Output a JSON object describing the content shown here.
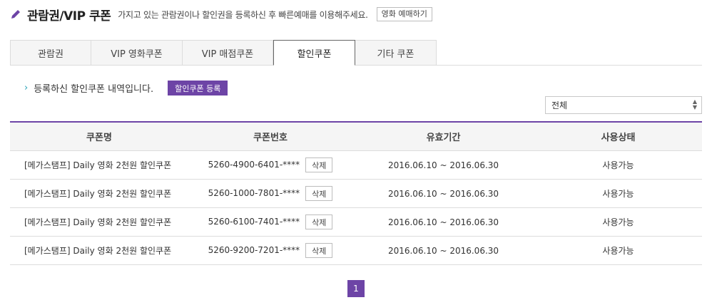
{
  "header": {
    "title": "관람권/VIP 쿠폰",
    "subtitle": "가지고 있는 관람권이나 할인권을 등록하신 후 빠른예매를 이용해주세요.",
    "booking_button": "영화 예매하기"
  },
  "tabs": [
    {
      "label": "관람권"
    },
    {
      "label": "VIP 영화쿠폰"
    },
    {
      "label": "VIP 매점쿠폰"
    },
    {
      "label": "할인쿠폰",
      "active": true
    },
    {
      "label": "기타 쿠폰"
    }
  ],
  "sub": {
    "text": "등록하신 할인쿠폰 내역입니다.",
    "register_button": "할인쿠폰 등록"
  },
  "filter": {
    "selected": "전체"
  },
  "table": {
    "headers": [
      "쿠폰명",
      "쿠폰번호",
      "유효기간",
      "사용상태"
    ],
    "delete_label": "삭제",
    "rows": [
      {
        "name": "[메가스탬프] Daily 영화 2천원 할인쿠폰",
        "number": "5260-4900-6401-****",
        "period": "2016.06.10 ~ 2016.06.30",
        "status": "사용가능"
      },
      {
        "name": "[메가스탬프] Daily 영화 2천원 할인쿠폰",
        "number": "5260-1000-7801-****",
        "period": "2016.06.10 ~ 2016.06.30",
        "status": "사용가능"
      },
      {
        "name": "[메가스탬프] Daily 영화 2천원 할인쿠폰",
        "number": "5260-6100-7401-****",
        "period": "2016.06.10 ~ 2016.06.30",
        "status": "사용가능"
      },
      {
        "name": "[메가스탬프] Daily 영화 2천원 할인쿠폰",
        "number": "5260-9200-7201-****",
        "period": "2016.06.10 ~ 2016.06.30",
        "status": "사용가능"
      }
    ]
  },
  "pagination": {
    "current": "1"
  },
  "colors": {
    "accent": "#6d44a6",
    "chevron": "#2aa3b8"
  }
}
